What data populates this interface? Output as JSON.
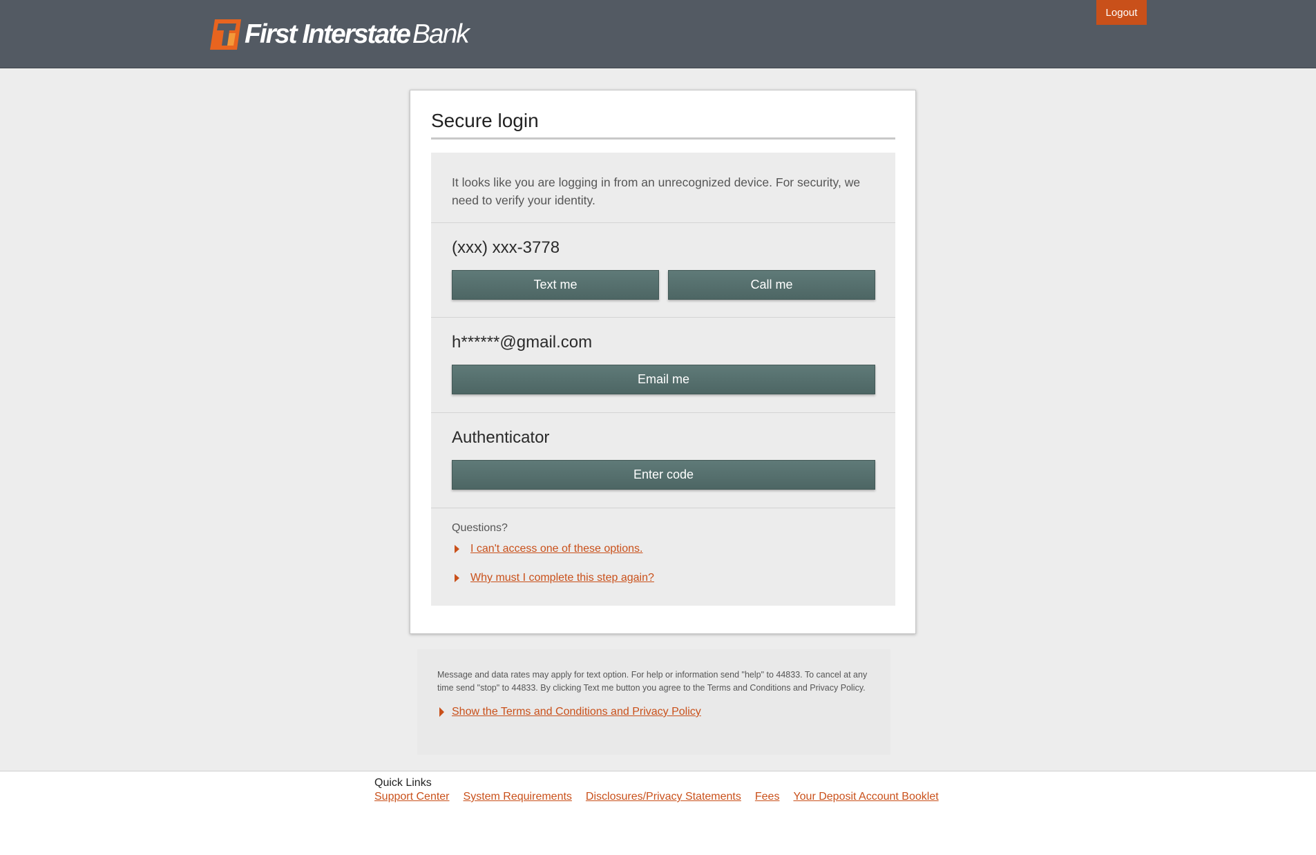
{
  "header": {
    "logo_bold": "First Interstate",
    "logo_light": "Bank",
    "logout_label": "Logout",
    "logo_icon": "first-interstate-logo-mark",
    "brand_color": "#c9501a",
    "header_color": "#535a63"
  },
  "card": {
    "title": "Secure login",
    "intro": "It looks like you are logging in from an unrecognized device. For security, we need to verify your identity.",
    "phone": {
      "label": "(xxx) xxx-3778",
      "text_button": "Text me",
      "call_button": "Call me"
    },
    "email": {
      "label": "h******@gmail.com",
      "email_button": "Email me"
    },
    "authenticator": {
      "label": "Authenticator",
      "code_button": "Enter code"
    },
    "questions": {
      "label": "Questions?",
      "links": [
        "I can't access one of these options.",
        "Why must I complete this step again?"
      ]
    }
  },
  "disclaimer": {
    "text": "Message and data rates may apply for text option. For help or information send \"help\" to 44833. To cancel at any time send \"stop\" to 44833. By clicking Text me button you agree to the Terms and Conditions and Privacy Policy.",
    "terms_link": "Show the Terms and Conditions and Privacy Policy"
  },
  "footer": {
    "title": "Quick Links",
    "links": [
      "Support Center",
      "System Requirements",
      "Disclosures/Privacy Statements",
      "Fees",
      "Your Deposit Account Booklet"
    ]
  }
}
